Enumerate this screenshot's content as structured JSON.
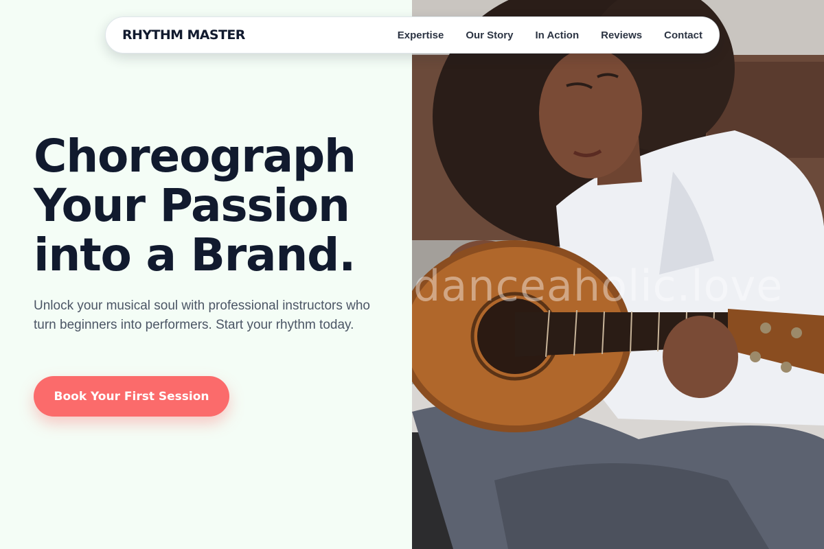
{
  "nav": {
    "brand": "RHYTHM MASTER",
    "links": [
      "Expertise",
      "Our Story",
      "In Action",
      "Reviews",
      "Contact"
    ]
  },
  "hero": {
    "title_lines": [
      "Choreograph",
      "Your Passion",
      "into a Brand."
    ],
    "subtitle": "Unlock your musical soul with professional instructors who turn beginners into performers. Start your rhythm today.",
    "cta_label": "Book Your First Session",
    "image_watermark": "danceaholic.love"
  },
  "colors": {
    "background": "#f4fdf6",
    "heading": "#111a2e",
    "body_text": "#4b5565",
    "accent": "#fb6b6b"
  }
}
